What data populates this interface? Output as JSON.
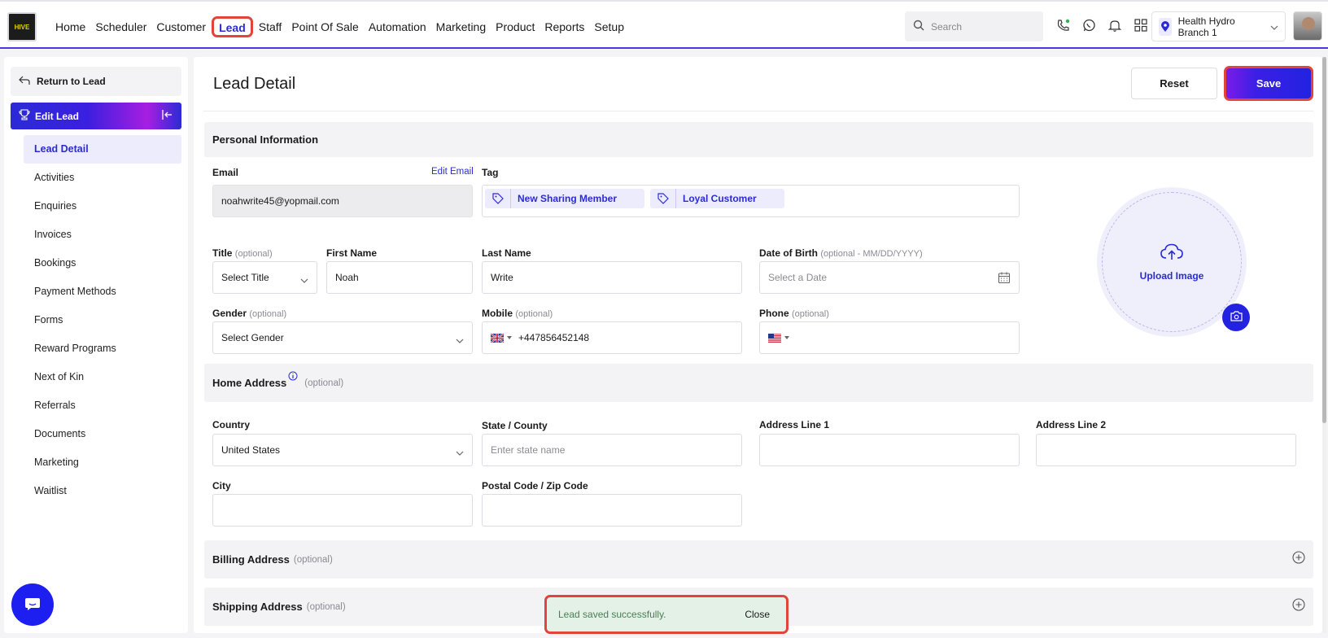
{
  "nav": {
    "logo_text": "HIVE",
    "items": [
      "Home",
      "Scheduler",
      "Customer",
      "Lead",
      "Staff",
      "Point Of Sale",
      "Automation",
      "Marketing",
      "Product",
      "Reports",
      "Setup"
    ],
    "active": "Lead",
    "search_placeholder": "Search",
    "branch": "Health Hydro Branch 1"
  },
  "sidebar": {
    "return_label": "Return to Lead",
    "edit_label": "Edit Lead",
    "items": [
      "Lead Detail",
      "Activities",
      "Enquiries",
      "Invoices",
      "Bookings",
      "Payment Methods",
      "Forms",
      "Reward Programs",
      "Next of Kin",
      "Referrals",
      "Documents",
      "Marketing",
      "Waitlist"
    ],
    "active": "Lead Detail"
  },
  "page": {
    "title": "Lead Detail",
    "reset_label": "Reset",
    "save_label": "Save"
  },
  "personal": {
    "heading": "Personal Information",
    "email_label": "Email",
    "edit_email": "Edit Email",
    "email_value": "noahwrite45@yopmail.com",
    "tag_label": "Tag",
    "tags": [
      "New Sharing Member",
      "Loyal Customer"
    ],
    "title_label": "Title",
    "title_value": "Select Title",
    "first_name_label": "First Name",
    "first_name_value": "Noah",
    "last_name_label": "Last Name",
    "last_name_value": "Write",
    "dob_label": "Date of Birth",
    "dob_hint": "(optional - MM/DD/YYYY)",
    "dob_placeholder": "Select a Date",
    "gender_label": "Gender",
    "gender_value": "Select Gender",
    "mobile_label": "Mobile",
    "mobile_value": "+447856452148",
    "phone_label": "Phone",
    "optional": "(optional)",
    "upload_label": "Upload Image"
  },
  "home_address": {
    "heading": "Home Address",
    "optional": "(optional)",
    "country_label": "Country",
    "country_value": "United States",
    "state_label": "State / County",
    "state_placeholder": "Enter state name",
    "addr1_label": "Address Line 1",
    "addr2_label": "Address Line 2",
    "city_label": "City",
    "postal_label": "Postal Code / Zip Code"
  },
  "billing": {
    "heading": "Billing Address",
    "optional": "(optional)"
  },
  "shipping": {
    "heading": "Shipping Address",
    "optional": "(optional)"
  },
  "toast": {
    "message": "Lead saved successfully.",
    "close": "Close"
  },
  "colors": {
    "accent": "#2b2bd6",
    "highlight": "#e0443a",
    "toast_bg": "#e4f1e6"
  }
}
